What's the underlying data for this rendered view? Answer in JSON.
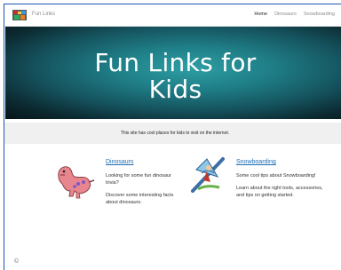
{
  "app": {
    "brand_name": "Fun Links"
  },
  "nav": {
    "items": [
      "Home",
      "Dinosaurs",
      "Snowboarding",
      "C"
    ]
  },
  "hero": {
    "title_line1": "Fun Links for",
    "title_line2": "Kids"
  },
  "banner": {
    "text": "This site has cool places for kids to visit on the internet."
  },
  "cards": [
    {
      "title": "Dinosaurs",
      "p1": "Looking for some fun dinosaur trivia?",
      "p2": "Discover some interesting facts about dinosaurs.",
      "icon": "dinosaur-icon"
    },
    {
      "title": "Snowboarding",
      "p1": "Some cool tips about Snowboarding!",
      "p2": "Learn about the right tools, accessories, and tips on getting started.",
      "icon": "snowboarder-icon"
    }
  ],
  "footer": {
    "symbol": "©"
  }
}
